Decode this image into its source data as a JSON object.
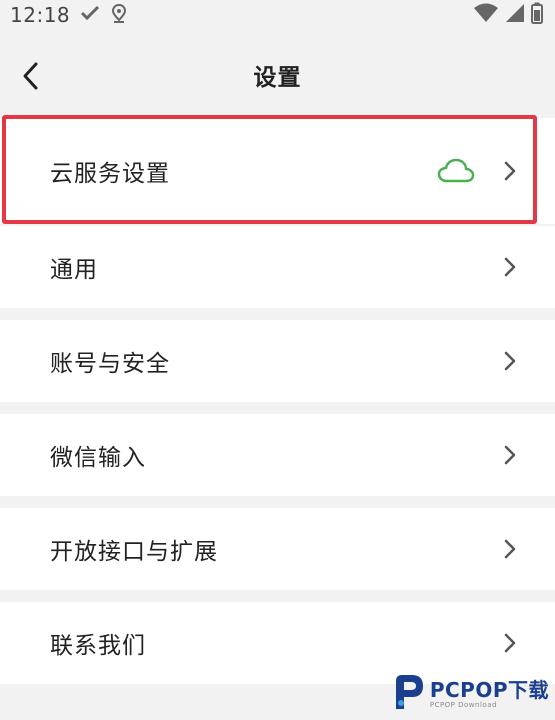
{
  "status_bar": {
    "time": "12:18",
    "icons": [
      "check-icon",
      "location-icon",
      "wifi-icon",
      "signal-icon",
      "battery-icon"
    ]
  },
  "header": {
    "back_icon": "chevron-left-icon",
    "title": "设置"
  },
  "settings": {
    "items": [
      {
        "label": "云服务设置",
        "icon": "cloud-icon",
        "highlighted": true
      },
      {
        "label": "通用"
      },
      {
        "label": "账号与安全"
      },
      {
        "label": "微信输入"
      },
      {
        "label": "开放接口与扩展"
      },
      {
        "label": "联系我们"
      }
    ]
  },
  "watermark": {
    "main": "PCPOP下载",
    "sub": "PCPOP Download"
  },
  "colors": {
    "highlight_border": "#e53846",
    "cloud_green": "#4caf50",
    "background": "#f2f2f2",
    "row_bg": "#ffffff",
    "watermark_blue": "#1b3f8f"
  }
}
